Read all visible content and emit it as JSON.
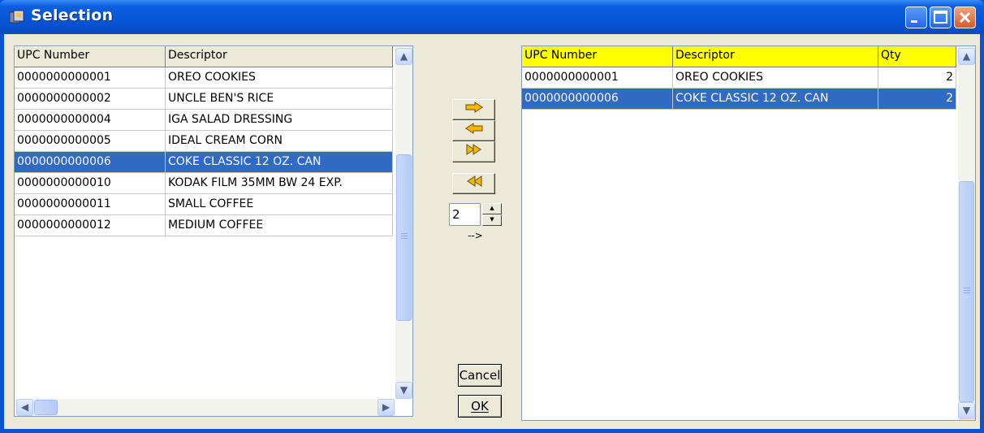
{
  "window": {
    "title": "Selection"
  },
  "left_grid": {
    "columns": [
      "UPC Number",
      "Descriptor"
    ],
    "rows": [
      [
        "0000000000001",
        "OREO COOKIES"
      ],
      [
        "0000000000002",
        "UNCLE BEN'S RICE"
      ],
      [
        "0000000000004",
        "IGA SALAD DRESSING"
      ],
      [
        "0000000000005",
        "IDEAL CREAM CORN"
      ],
      [
        "0000000000006",
        "COKE CLASSIC 12 OZ. CAN"
      ],
      [
        "0000000000010",
        "KODAK FILM 35MM BW 24 EXP."
      ],
      [
        "0000000000011",
        "SMALL COFFEE"
      ],
      [
        "0000000000012",
        "MEDIUM COFFEE"
      ]
    ],
    "selected_row": 4
  },
  "right_grid": {
    "columns": [
      "UPC Number",
      "Descriptor",
      "Qty"
    ],
    "rows": [
      [
        "0000000000001",
        "OREO COOKIES",
        "2"
      ],
      [
        "0000000000006",
        "COKE CLASSIC 12 OZ. CAN",
        "2"
      ]
    ],
    "selected_row": 1
  },
  "controls": {
    "add_icon": "arrow-right-icon",
    "remove_icon": "arrow-left-icon",
    "add_all_icon": "double-arrow-right-icon",
    "remove_all_icon": "double-arrow-left-icon",
    "quantity_value": "2",
    "quantity_hint": "-->",
    "cancel_label": "Cancel",
    "ok_label": "OK"
  },
  "colors": {
    "title_bar": "#0656d6",
    "selection": "#316ac5",
    "right_header": "#ffff00",
    "arrow_fill": "#f5b700"
  }
}
